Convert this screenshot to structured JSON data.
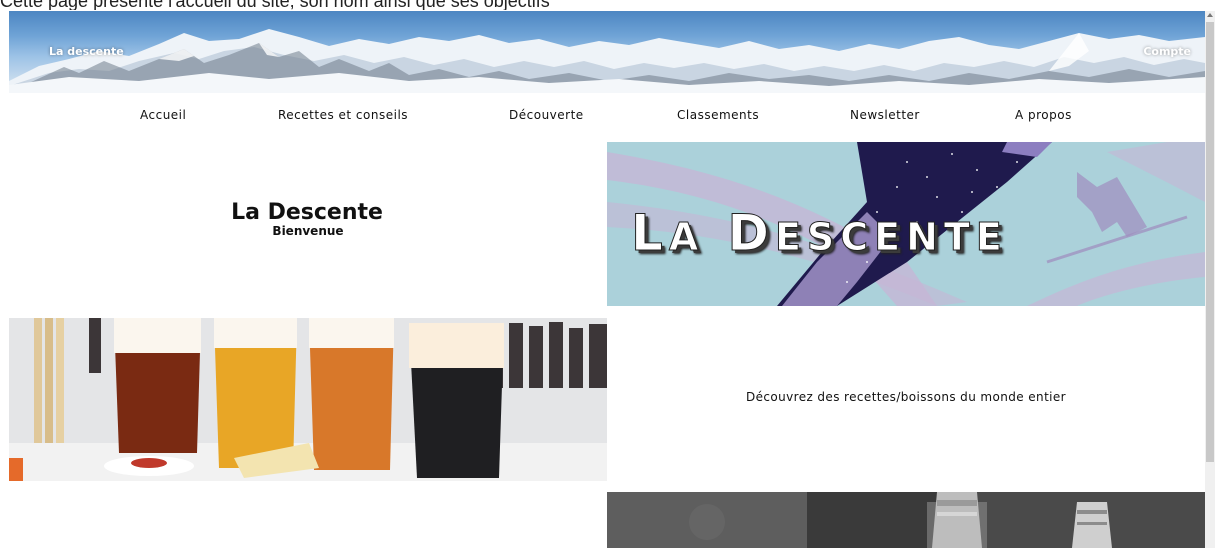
{
  "caption": "Cette page présente l'accueil du site, son nom ainsi que ses objectifs",
  "header": {
    "brand": "La descente",
    "account": "Compte"
  },
  "nav": {
    "items": [
      {
        "label": "Accueil"
      },
      {
        "label": "Recettes et conseils"
      },
      {
        "label": "Découverte"
      },
      {
        "label": "Classements"
      },
      {
        "label": "Newsletter"
      },
      {
        "label": "A propos"
      }
    ]
  },
  "hero": {
    "title": "La Descente",
    "subtitle": "Bienvenue"
  },
  "logo": {
    "word1_initial": "L",
    "word1_rest": "A",
    "word2_initial": "D",
    "word2_rest": "ESCENTE"
  },
  "discover": {
    "text": "Découvrez des recettes/boissons du monde entier"
  },
  "colors": {
    "logo_bg": "#abd1da",
    "sky": "#6fa3d6"
  },
  "icons": {
    "scroll_up": "triangle-up"
  }
}
